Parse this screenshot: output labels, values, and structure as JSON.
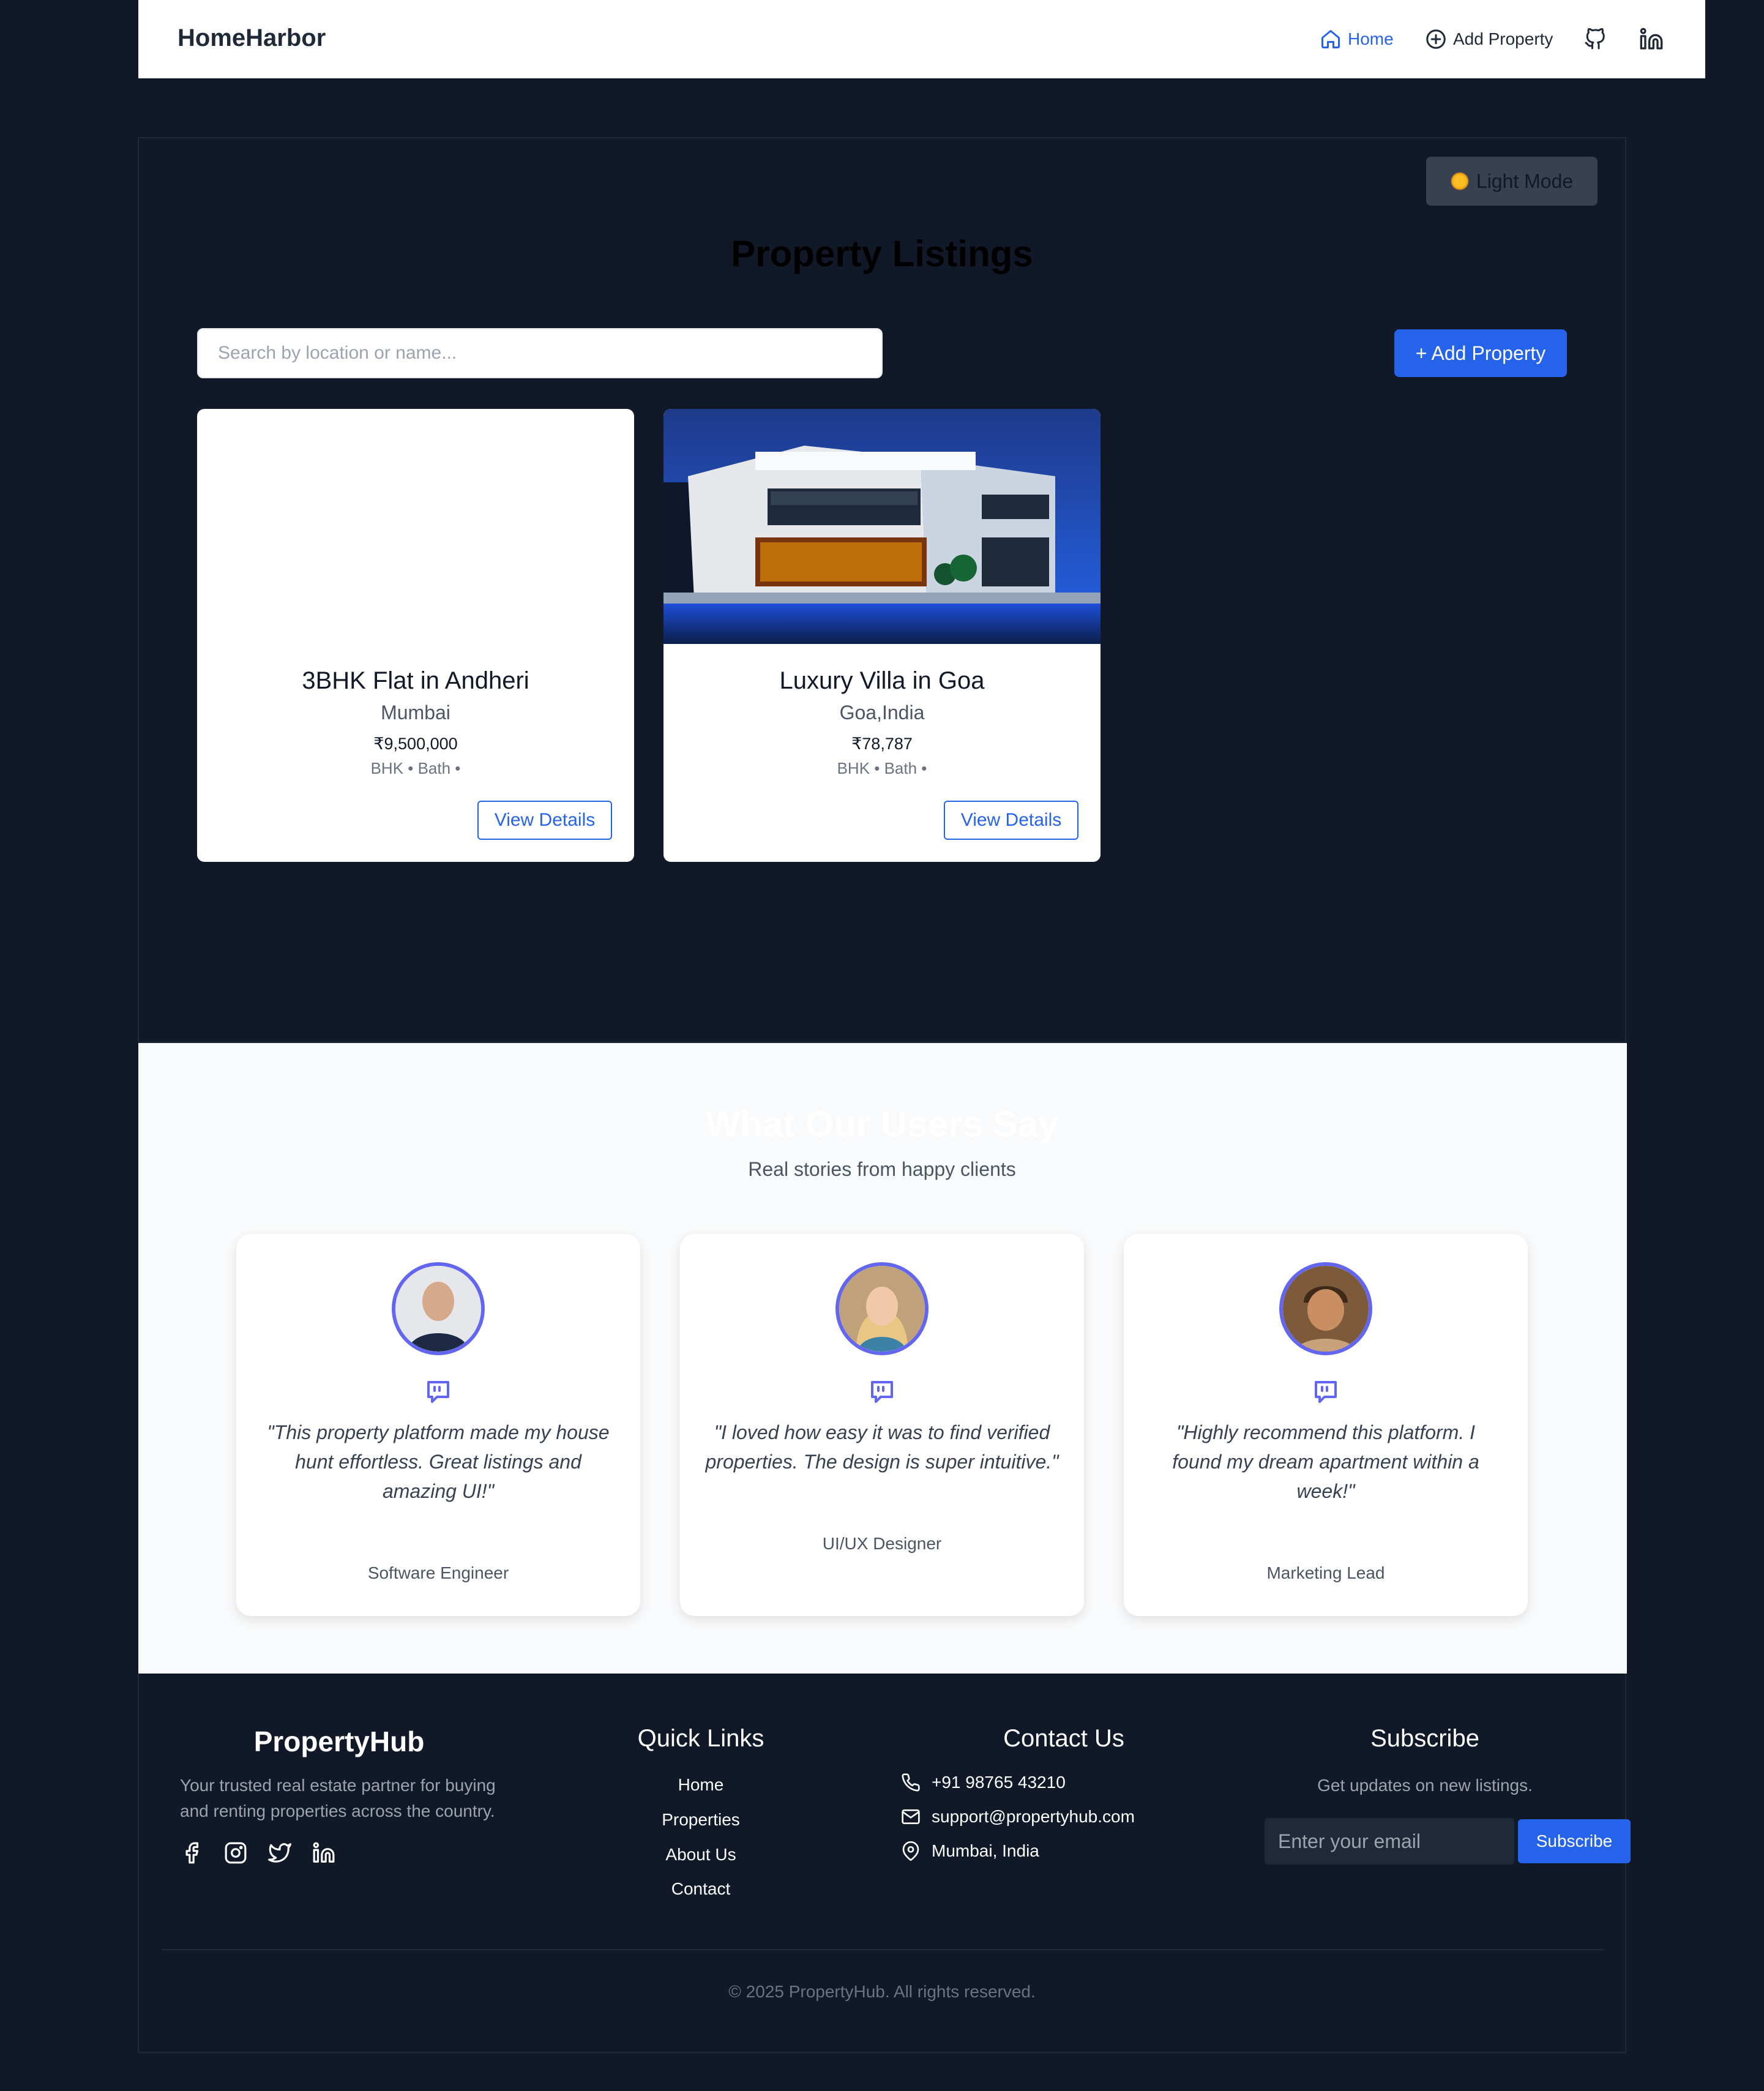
{
  "navbar": {
    "brand": "HomeHarbor",
    "home": "Home",
    "add_property": "Add Property",
    "icons": [
      "home-icon",
      "plus-circle-icon",
      "github-icon",
      "linkedin-icon"
    ]
  },
  "main": {
    "theme_toggle": "Light Mode",
    "title": "Property Listings",
    "search_placeholder": "Search by location or name...",
    "add_button": "+ Add Property",
    "listings": [
      {
        "title": "3BHK Flat in Andheri",
        "location": "Mumbai",
        "price": "₹9,500,000",
        "meta": "BHK • Bath •",
        "button": "View Details",
        "has_image": false
      },
      {
        "title": "Luxury Villa in Goa",
        "location": "Goa,India",
        "price": "₹78,787",
        "meta": "BHK • Bath •",
        "button": "View Details",
        "has_image": true
      }
    ]
  },
  "testimonials": {
    "title": "What Our Users Say",
    "subtitle": "Real stories from happy clients",
    "items": [
      {
        "quote": "\"This property platform made my house hunt effortless. Great listings and amazing UI!\"",
        "role": "Software Engineer"
      },
      {
        "quote": "\"I loved how easy it was to find verified properties. The design is super intuitive.\"",
        "role": "UI/UX Designer"
      },
      {
        "quote": "\"Highly recommend this platform. I found my dream apartment within a week!\"",
        "role": "Marketing Lead"
      }
    ]
  },
  "footer": {
    "brand": "PropertyHub",
    "tagline": "Your trusted real estate partner for buying and renting properties across the country.",
    "social_icons": [
      "facebook-icon",
      "instagram-icon",
      "twitter-icon",
      "linkedin-icon"
    ],
    "quick_links": {
      "heading": "Quick Links",
      "items": [
        "Home",
        "Properties",
        "About Us",
        "Contact"
      ]
    },
    "contact": {
      "heading": "Contact Us",
      "phone": "+91 98765 43210",
      "email": "support@propertyhub.com",
      "address": "Mumbai, India"
    },
    "subscribe": {
      "heading": "Subscribe",
      "text": "Get updates on new listings.",
      "placeholder": "Enter your email",
      "button": "Subscribe"
    },
    "copyright": "© 2025 PropertyHub. All rights reserved."
  },
  "colors": {
    "page_bg": "#111827",
    "accent": "#2563eb",
    "avatar_ring": "#6366f1",
    "testimonial_bg": "#f9fafb"
  }
}
